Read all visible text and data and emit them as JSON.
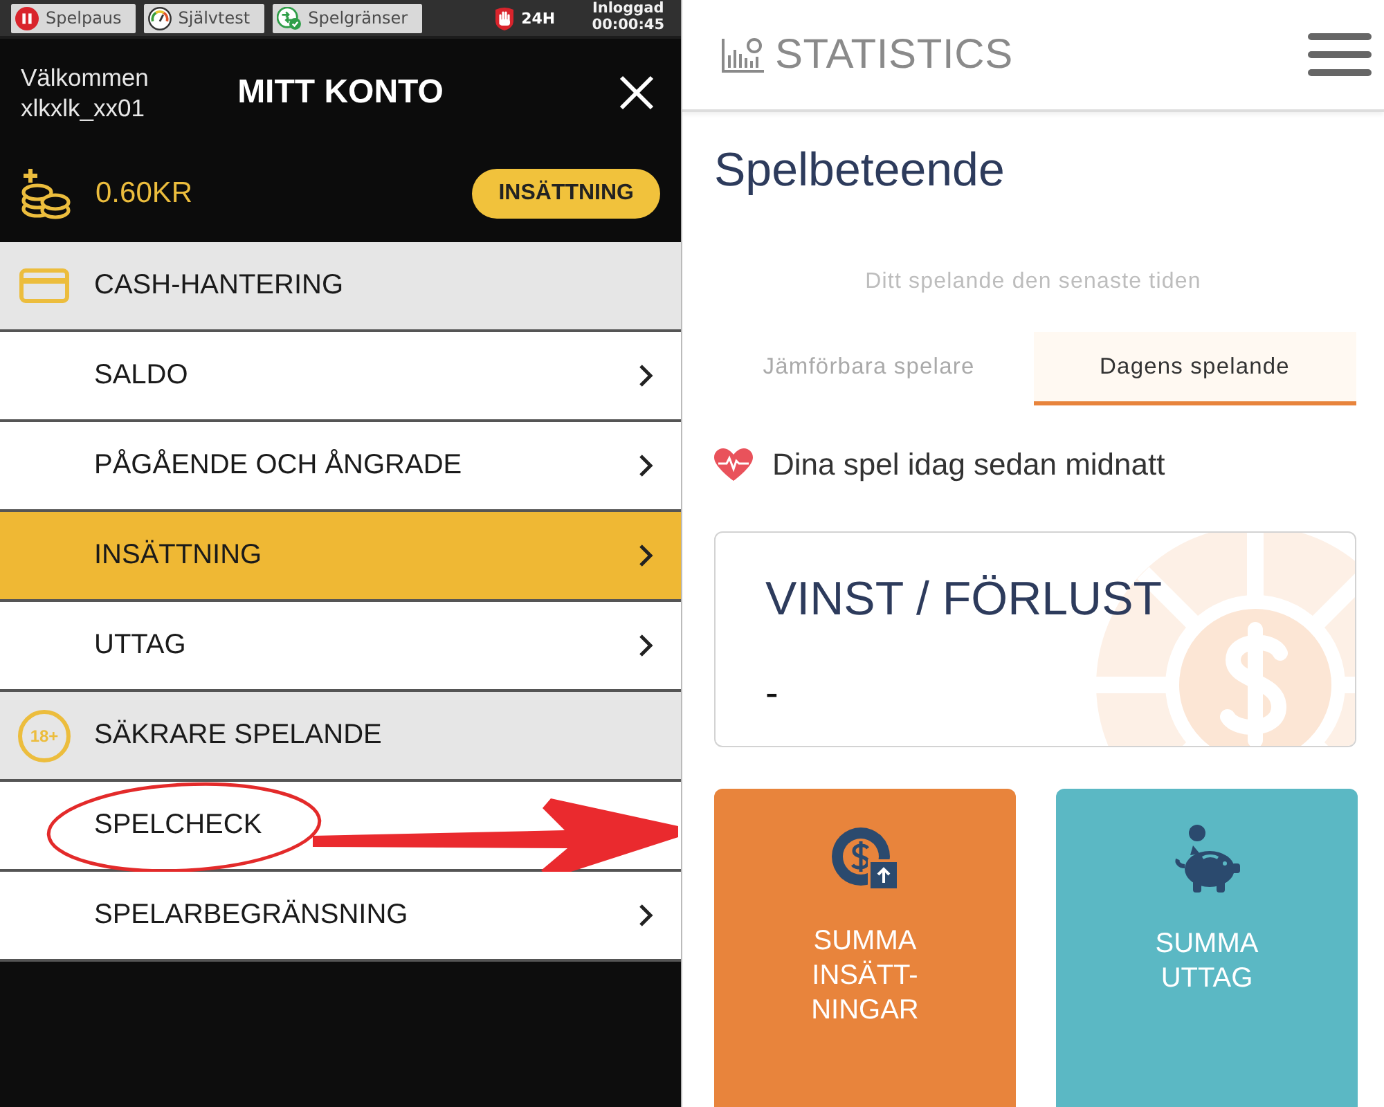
{
  "status_bar": {
    "buttons": [
      {
        "kind": "pause",
        "label": "Spelpaus"
      },
      {
        "kind": "gauge",
        "label": "Självtest"
      },
      {
        "kind": "limits",
        "label": "Spelgränser"
      }
    ],
    "limit_label": "24H",
    "session_label": "Inloggad",
    "session_time": "00:00:45"
  },
  "account": {
    "greeting": "Välkommen",
    "username": "xlkxlk_xx01",
    "title": "MITT KONTO",
    "balance": "0.60KR",
    "deposit_button": "INSÄTTNING"
  },
  "menu": [
    {
      "title": "CASH-HANTERING",
      "items": [
        {
          "label": "SALDO",
          "selected": false,
          "chevron": true,
          "circled": false
        },
        {
          "label": "PÅGÅENDE OCH ÅNGRADE",
          "selected": false,
          "chevron": true,
          "circled": false
        },
        {
          "label": "INSÄTTNING",
          "selected": true,
          "chevron": true,
          "circled": false
        },
        {
          "label": "UTTAG",
          "selected": false,
          "chevron": true,
          "circled": false
        }
      ]
    },
    {
      "title": "SÄKRARE SPELANDE",
      "badge": "18+",
      "items": [
        {
          "label": "SPELCHECK",
          "selected": false,
          "chevron": false,
          "circled": true
        },
        {
          "label": "SPELARBEGRÄNSNING",
          "selected": false,
          "chevron": true,
          "circled": false
        }
      ]
    }
  ],
  "statistics": {
    "app_title": "STATISTICS",
    "heading": "Spelbeteende",
    "subtitle": "Ditt spelande den senaste tiden",
    "tabs": [
      {
        "label": "Jämförbara spelare",
        "selected": false
      },
      {
        "label": "Dagens spelande",
        "selected": true
      }
    ],
    "today_label": "Dina spel idag sedan midnatt",
    "result_card": {
      "title": "VINST / FÖRLUST",
      "value": "-"
    },
    "tiles": [
      {
        "kind": "deposit",
        "label": "SUMMA INSÄTT-NINGAR",
        "color": "#e8843c"
      },
      {
        "kind": "withdrawal",
        "label": "SUMMA UTTAG",
        "color": "#5bb8c4"
      }
    ]
  }
}
